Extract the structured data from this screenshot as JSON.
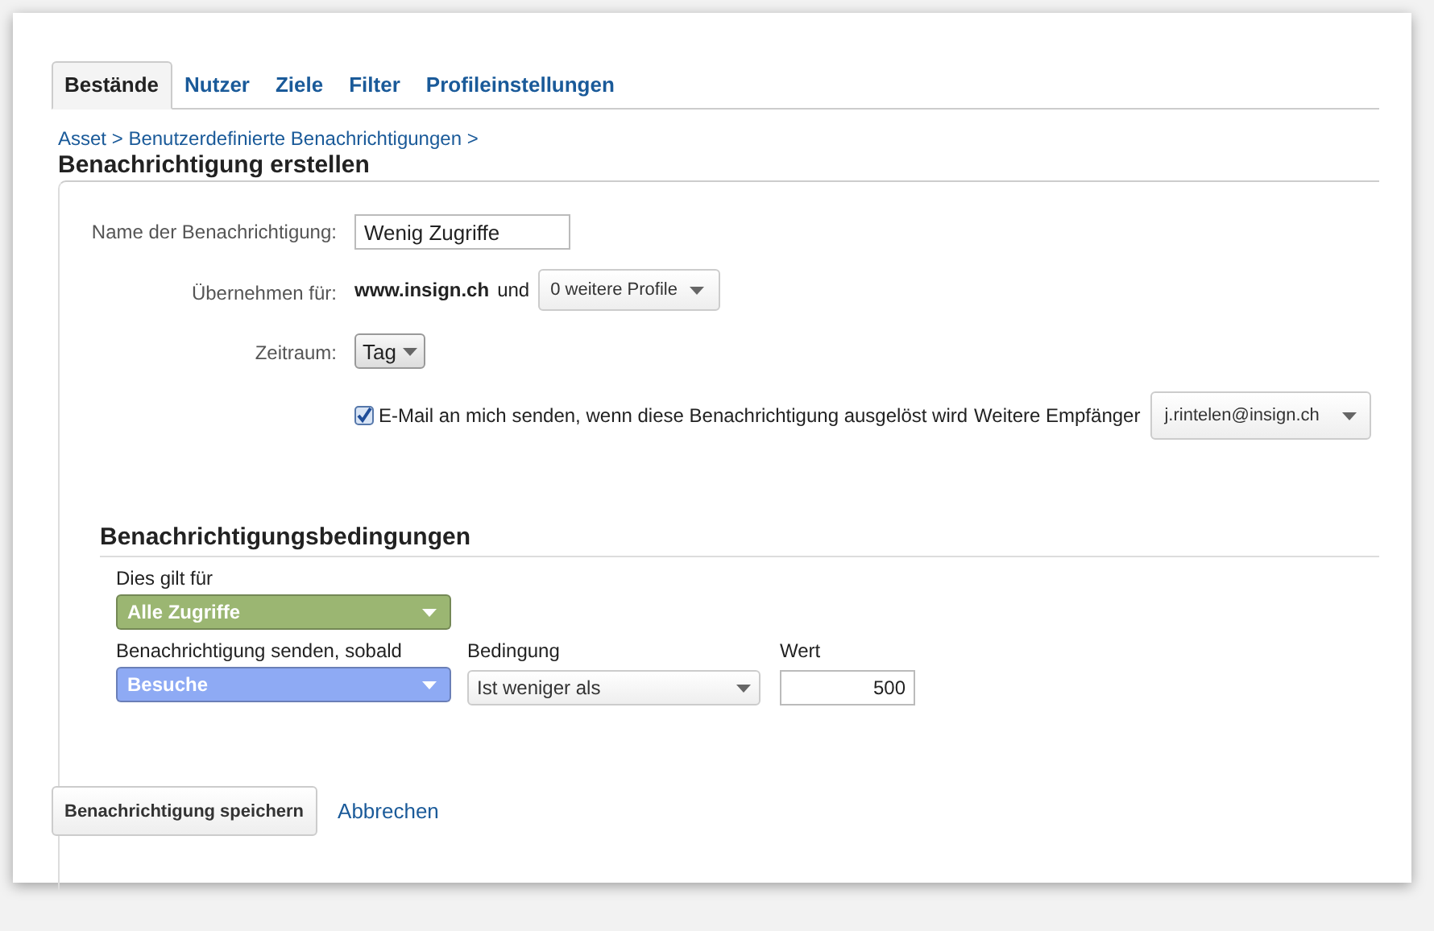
{
  "tabs": [
    {
      "label": "Bestände",
      "selected": true
    },
    {
      "label": "Nutzer",
      "selected": false
    },
    {
      "label": "Ziele",
      "selected": false
    },
    {
      "label": "Filter",
      "selected": false
    },
    {
      "label": "Profileinstellungen",
      "selected": false
    }
  ],
  "breadcrumb": "Asset > Benutzerdefinierte Benachrichtigungen >",
  "title": "Benachrichtigung erstellen",
  "form": {
    "name": {
      "label": "Name der Benachrichtigung:",
      "value": "Wenig Zugriffe"
    },
    "apply": {
      "label": "Übernehmen für:",
      "site": "www.insign.ch",
      "conjunction": "und",
      "dropdown": "0 weitere Profile"
    },
    "period": {
      "label": "Zeitraum:",
      "dropdown": "Tag"
    },
    "email": {
      "checked": true,
      "text": "E-Mail an mich senden, wenn diese Benachrichtigung ausgelöst wird",
      "recipients_label": "Weitere Empfänger",
      "recipients": "j.rintelen@insign.ch"
    }
  },
  "conditions": {
    "title": "Benachrichtigungsbedingungen",
    "applies_label": "Dies gilt für",
    "applies": {
      "value": "Alle Zugriffe",
      "color": "#9bb672"
    },
    "metric_label": "Benachrichtigung senden, sobald",
    "metric": {
      "value": "Besuche",
      "color": "#8eaaf4"
    },
    "condition_label": "Bedingung",
    "condition": "Ist weniger als",
    "value_label": "Wert",
    "value": "500"
  },
  "buttons": {
    "save": "Benachrichtigung speichern",
    "cancel": "Abbrechen"
  }
}
